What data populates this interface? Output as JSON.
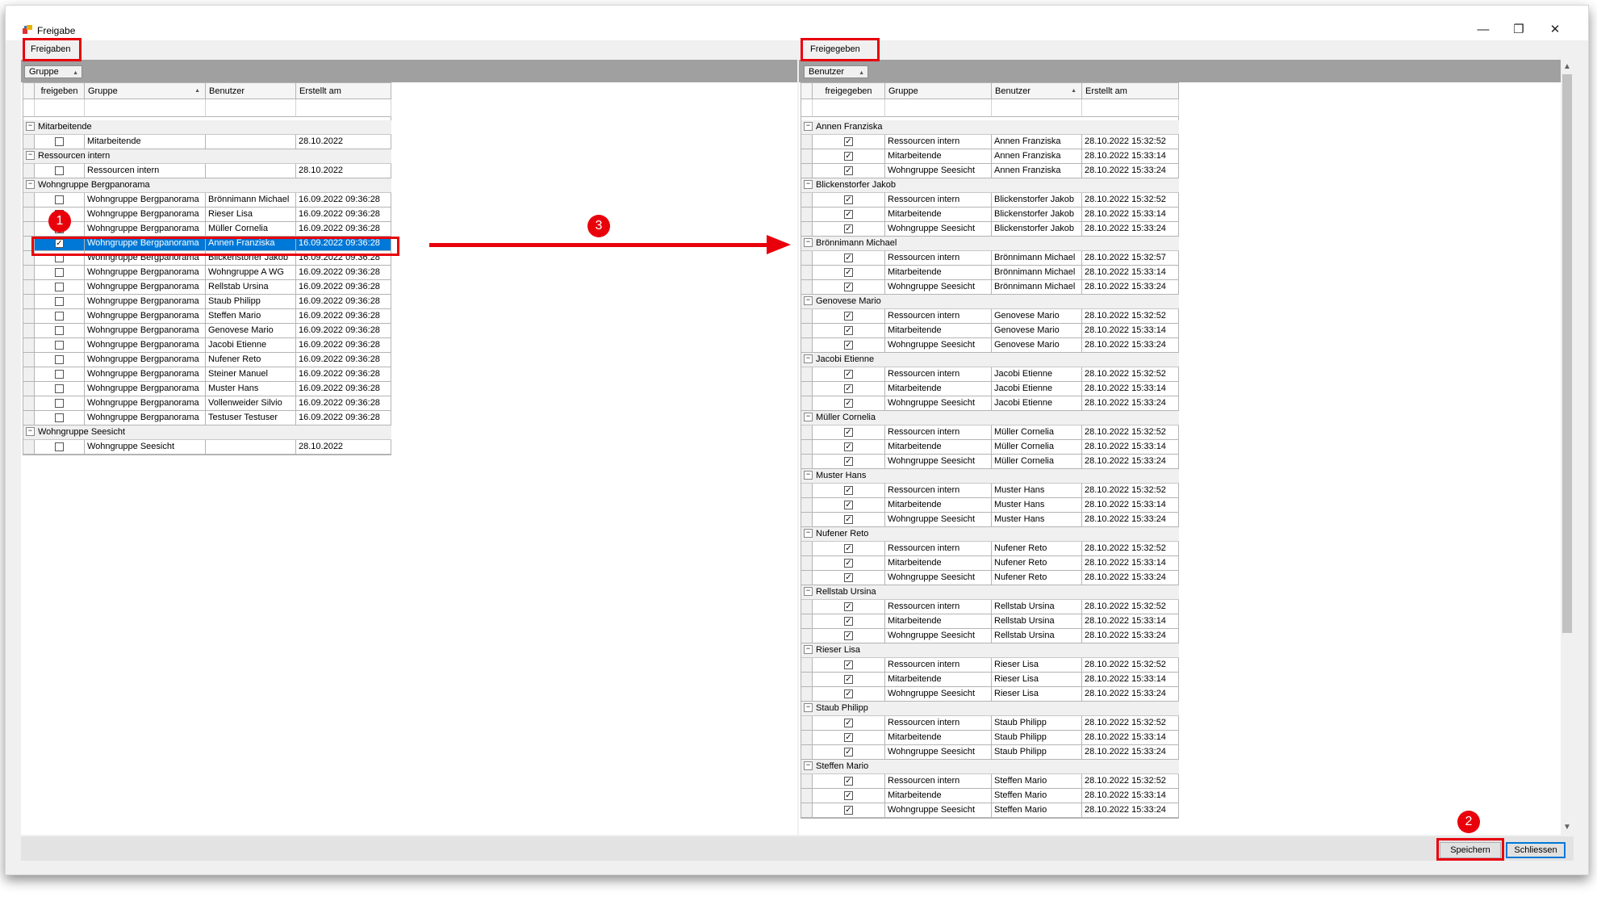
{
  "window": {
    "title": "Freigabe",
    "controls": [
      "—",
      "❐",
      "✕"
    ]
  },
  "left": {
    "tab_label": "Freigaben",
    "group_chip": "Gruppe",
    "columns": [
      "freigeben",
      "Gruppe",
      "Benutzer",
      "Erstellt am"
    ],
    "groups": [
      {
        "name": "Mitarbeitende",
        "rows": [
          {
            "checked": false,
            "selected": false,
            "gruppe": "Mitarbeitende",
            "benutzer": "",
            "datum": "28.10.2022"
          }
        ]
      },
      {
        "name": "Ressourcen intern",
        "rows": [
          {
            "checked": false,
            "selected": false,
            "gruppe": "Ressourcen intern",
            "benutzer": "",
            "datum": "28.10.2022"
          }
        ]
      },
      {
        "name": "Wohngruppe Bergpanorama",
        "rows": [
          {
            "checked": false,
            "selected": false,
            "gruppe": "Wohngruppe Bergpanorama",
            "benutzer": "Brönnimann Michael",
            "datum": "16.09.2022 09:36:28"
          },
          {
            "checked": false,
            "selected": false,
            "gruppe": "Wohngruppe Bergpanorama",
            "benutzer": "Rieser Lisa",
            "datum": "16.09.2022 09:36:28"
          },
          {
            "checked": false,
            "selected": false,
            "gruppe": "Wohngruppe Bergpanorama",
            "benutzer": "Müller Cornelia",
            "datum": "16.09.2022 09:36:28"
          },
          {
            "checked": true,
            "selected": true,
            "gruppe": "Wohngruppe Bergpanorama",
            "benutzer": "Annen Franziska",
            "datum": "16.09.2022 09:36:28"
          },
          {
            "checked": false,
            "selected": false,
            "gruppe": "Wohngruppe Bergpanorama",
            "benutzer": "Blickenstorfer Jakob",
            "datum": "16.09.2022 09:36:28"
          },
          {
            "checked": false,
            "selected": false,
            "gruppe": "Wohngruppe Bergpanorama",
            "benutzer": "Wohngruppe A WG",
            "datum": "16.09.2022 09:36:28"
          },
          {
            "checked": false,
            "selected": false,
            "gruppe": "Wohngruppe Bergpanorama",
            "benutzer": "Rellstab Ursina",
            "datum": "16.09.2022 09:36:28"
          },
          {
            "checked": false,
            "selected": false,
            "gruppe": "Wohngruppe Bergpanorama",
            "benutzer": "Staub Philipp",
            "datum": "16.09.2022 09:36:28"
          },
          {
            "checked": false,
            "selected": false,
            "gruppe": "Wohngruppe Bergpanorama",
            "benutzer": "Steffen Mario",
            "datum": "16.09.2022 09:36:28"
          },
          {
            "checked": false,
            "selected": false,
            "gruppe": "Wohngruppe Bergpanorama",
            "benutzer": "Genovese Mario",
            "datum": "16.09.2022 09:36:28"
          },
          {
            "checked": false,
            "selected": false,
            "gruppe": "Wohngruppe Bergpanorama",
            "benutzer": "Jacobi Etienne",
            "datum": "16.09.2022 09:36:28"
          },
          {
            "checked": false,
            "selected": false,
            "gruppe": "Wohngruppe Bergpanorama",
            "benutzer": "Nufener Reto",
            "datum": "16.09.2022 09:36:28"
          },
          {
            "checked": false,
            "selected": false,
            "gruppe": "Wohngruppe Bergpanorama",
            "benutzer": "Steiner Manuel",
            "datum": "16.09.2022 09:36:28"
          },
          {
            "checked": false,
            "selected": false,
            "gruppe": "Wohngruppe Bergpanorama",
            "benutzer": "Muster Hans",
            "datum": "16.09.2022 09:36:28"
          },
          {
            "checked": false,
            "selected": false,
            "gruppe": "Wohngruppe Bergpanorama",
            "benutzer": "Vollenweider Silvio",
            "datum": "16.09.2022 09:36:28"
          },
          {
            "checked": false,
            "selected": false,
            "gruppe": "Wohngruppe Bergpanorama",
            "benutzer": "Testuser Testuser",
            "datum": "16.09.2022 09:36:28"
          }
        ]
      },
      {
        "name": "Wohngruppe Seesicht",
        "rows": [
          {
            "checked": false,
            "selected": false,
            "gruppe": "Wohngruppe Seesicht",
            "benutzer": "",
            "datum": "28.10.2022"
          }
        ]
      }
    ]
  },
  "right": {
    "tab_label": "Freigegeben",
    "group_chip": "Benutzer",
    "columns": [
      "freigegeben",
      "Gruppe",
      "Benutzer",
      "Erstellt am"
    ],
    "groups": [
      {
        "name": "Annen Franziska",
        "rows": [
          {
            "checked": true,
            "gruppe": "Ressourcen intern",
            "benutzer": "Annen Franziska",
            "datum": "28.10.2022 15:32:52"
          },
          {
            "checked": true,
            "gruppe": "Mitarbeitende",
            "benutzer": "Annen Franziska",
            "datum": "28.10.2022 15:33:14"
          },
          {
            "checked": true,
            "gruppe": "Wohngruppe Seesicht",
            "benutzer": "Annen Franziska",
            "datum": "28.10.2022 15:33:24"
          }
        ]
      },
      {
        "name": "Blickenstorfer Jakob",
        "rows": [
          {
            "checked": true,
            "gruppe": "Ressourcen intern",
            "benutzer": "Blickenstorfer Jakob",
            "datum": "28.10.2022 15:32:52"
          },
          {
            "checked": true,
            "gruppe": "Mitarbeitende",
            "benutzer": "Blickenstorfer Jakob",
            "datum": "28.10.2022 15:33:14"
          },
          {
            "checked": true,
            "gruppe": "Wohngruppe Seesicht",
            "benutzer": "Blickenstorfer Jakob",
            "datum": "28.10.2022 15:33:24"
          }
        ]
      },
      {
        "name": "Brönnimann Michael",
        "rows": [
          {
            "checked": true,
            "gruppe": "Ressourcen intern",
            "benutzer": "Brönnimann Michael",
            "datum": "28.10.2022 15:32:57"
          },
          {
            "checked": true,
            "gruppe": "Mitarbeitende",
            "benutzer": "Brönnimann Michael",
            "datum": "28.10.2022 15:33:14"
          },
          {
            "checked": true,
            "gruppe": "Wohngruppe Seesicht",
            "benutzer": "Brönnimann Michael",
            "datum": "28.10.2022 15:33:24"
          }
        ]
      },
      {
        "name": "Genovese Mario",
        "rows": [
          {
            "checked": true,
            "gruppe": "Ressourcen intern",
            "benutzer": "Genovese Mario",
            "datum": "28.10.2022 15:32:52"
          },
          {
            "checked": true,
            "gruppe": "Mitarbeitende",
            "benutzer": "Genovese Mario",
            "datum": "28.10.2022 15:33:14"
          },
          {
            "checked": true,
            "gruppe": "Wohngruppe Seesicht",
            "benutzer": "Genovese Mario",
            "datum": "28.10.2022 15:33:24"
          }
        ]
      },
      {
        "name": "Jacobi Etienne",
        "rows": [
          {
            "checked": true,
            "gruppe": "Ressourcen intern",
            "benutzer": "Jacobi Etienne",
            "datum": "28.10.2022 15:32:52"
          },
          {
            "checked": true,
            "gruppe": "Mitarbeitende",
            "benutzer": "Jacobi Etienne",
            "datum": "28.10.2022 15:33:14"
          },
          {
            "checked": true,
            "gruppe": "Wohngruppe Seesicht",
            "benutzer": "Jacobi Etienne",
            "datum": "28.10.2022 15:33:24"
          }
        ]
      },
      {
        "name": "Müller Cornelia",
        "rows": [
          {
            "checked": true,
            "gruppe": "Ressourcen intern",
            "benutzer": "Müller Cornelia",
            "datum": "28.10.2022 15:32:52"
          },
          {
            "checked": true,
            "gruppe": "Mitarbeitende",
            "benutzer": "Müller Cornelia",
            "datum": "28.10.2022 15:33:14"
          },
          {
            "checked": true,
            "gruppe": "Wohngruppe Seesicht",
            "benutzer": "Müller Cornelia",
            "datum": "28.10.2022 15:33:24"
          }
        ]
      },
      {
        "name": "Muster Hans",
        "rows": [
          {
            "checked": true,
            "gruppe": "Ressourcen intern",
            "benutzer": "Muster Hans",
            "datum": "28.10.2022 15:32:52"
          },
          {
            "checked": true,
            "gruppe": "Mitarbeitende",
            "benutzer": "Muster Hans",
            "datum": "28.10.2022 15:33:14"
          },
          {
            "checked": true,
            "gruppe": "Wohngruppe Seesicht",
            "benutzer": "Muster Hans",
            "datum": "28.10.2022 15:33:24"
          }
        ]
      },
      {
        "name": "Nufener Reto",
        "rows": [
          {
            "checked": true,
            "gruppe": "Ressourcen intern",
            "benutzer": "Nufener Reto",
            "datum": "28.10.2022 15:32:52"
          },
          {
            "checked": true,
            "gruppe": "Mitarbeitende",
            "benutzer": "Nufener Reto",
            "datum": "28.10.2022 15:33:14"
          },
          {
            "checked": true,
            "gruppe": "Wohngruppe Seesicht",
            "benutzer": "Nufener Reto",
            "datum": "28.10.2022 15:33:24"
          }
        ]
      },
      {
        "name": "Rellstab Ursina",
        "rows": [
          {
            "checked": true,
            "gruppe": "Ressourcen intern",
            "benutzer": "Rellstab Ursina",
            "datum": "28.10.2022 15:32:52"
          },
          {
            "checked": true,
            "gruppe": "Mitarbeitende",
            "benutzer": "Rellstab Ursina",
            "datum": "28.10.2022 15:33:14"
          },
          {
            "checked": true,
            "gruppe": "Wohngruppe Seesicht",
            "benutzer": "Rellstab Ursina",
            "datum": "28.10.2022 15:33:24"
          }
        ]
      },
      {
        "name": "Rieser Lisa",
        "rows": [
          {
            "checked": true,
            "gruppe": "Ressourcen intern",
            "benutzer": "Rieser Lisa",
            "datum": "28.10.2022 15:32:52"
          },
          {
            "checked": true,
            "gruppe": "Mitarbeitende",
            "benutzer": "Rieser Lisa",
            "datum": "28.10.2022 15:33:14"
          },
          {
            "checked": true,
            "gruppe": "Wohngruppe Seesicht",
            "benutzer": "Rieser Lisa",
            "datum": "28.10.2022 15:33:24"
          }
        ]
      },
      {
        "name": "Staub Philipp",
        "rows": [
          {
            "checked": true,
            "gruppe": "Ressourcen intern",
            "benutzer": "Staub Philipp",
            "datum": "28.10.2022 15:32:52"
          },
          {
            "checked": true,
            "gruppe": "Mitarbeitende",
            "benutzer": "Staub Philipp",
            "datum": "28.10.2022 15:33:14"
          },
          {
            "checked": true,
            "gruppe": "Wohngruppe Seesicht",
            "benutzer": "Staub Philipp",
            "datum": "28.10.2022 15:33:24"
          }
        ]
      },
      {
        "name": "Steffen Mario",
        "rows": [
          {
            "checked": true,
            "gruppe": "Ressourcen intern",
            "benutzer": "Steffen Mario",
            "datum": "28.10.2022 15:32:52"
          },
          {
            "checked": true,
            "gruppe": "Mitarbeitende",
            "benutzer": "Steffen Mario",
            "datum": "28.10.2022 15:33:14"
          },
          {
            "checked": true,
            "gruppe": "Wohngruppe Seesicht",
            "benutzer": "Steffen Mario",
            "datum": "28.10.2022 15:33:24"
          }
        ]
      }
    ]
  },
  "buttons": {
    "save": "Speichern",
    "close": "Schliessen"
  },
  "annotations": {
    "marker1": "1",
    "marker2": "2",
    "marker3": "3",
    "color": "#e8000b"
  },
  "colors": {
    "selection": "#0078d7",
    "header_band": "#a0a0a0"
  }
}
